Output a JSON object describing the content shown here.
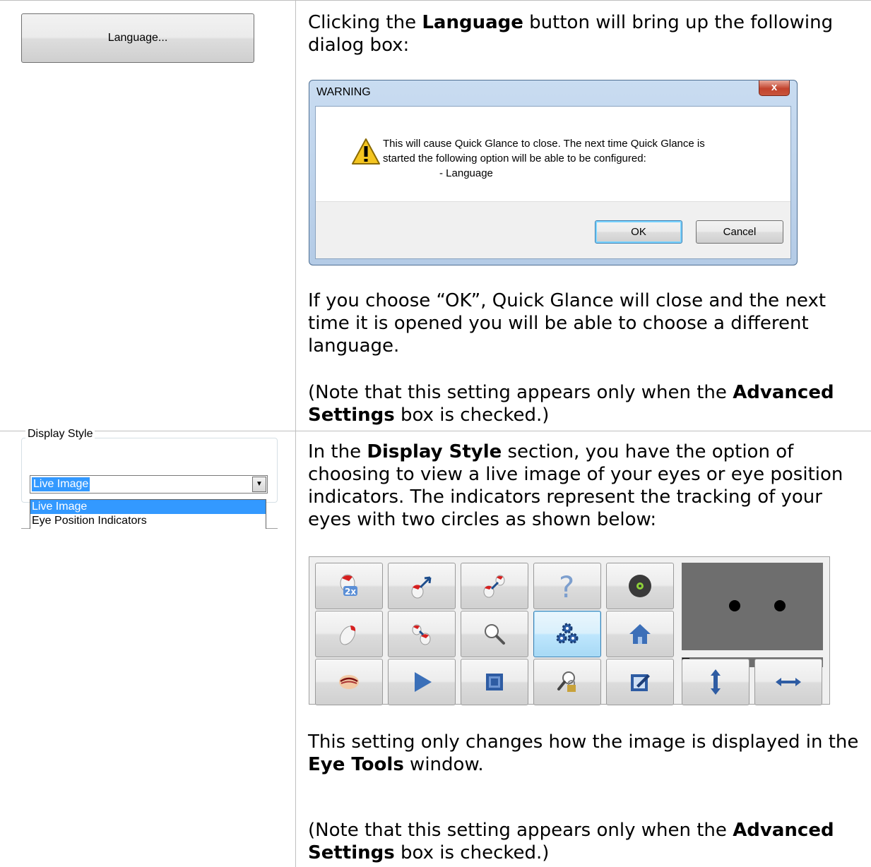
{
  "row1": {
    "language_button_label": "Language...",
    "intro": {
      "pre": "Clicking the ",
      "bold": "Language",
      "post": " button will bring up the following dialog box:"
    },
    "dialog": {
      "title": "WARNING",
      "close_label": "x",
      "message_line1": "This will cause Quick Glance to close. The next time Quick Glance is",
      "message_line2": "started the following option will be able to be configured:",
      "message_line3": "- Language",
      "ok_label": "OK",
      "cancel_label": "Cancel"
    },
    "para2": "If you choose “OK”, Quick Glance will close and the next time it is opened you will be able to choose a different language.",
    "note": {
      "pre": "(Note that this setting appears only when the ",
      "bold": "Advanced Settings",
      "post": " box is checked.)"
    }
  },
  "row2": {
    "group_label": "Display Style",
    "combo_value": "Live Image",
    "options": [
      "Live Image",
      "Eye Position Indicators"
    ],
    "para1": {
      "pre": "In the ",
      "bold": "Display Style",
      "post": " section, you have the option of choosing to view a live image of your eyes or eye position indicators. The indicators represent  the tracking of your eyes with two circles as shown below:"
    },
    "eye_tools": {
      "buttons": [
        {
          "icon": "zoom-2x-icon"
        },
        {
          "icon": "cursor-arrow-icon"
        },
        {
          "icon": "drag-icon"
        },
        {
          "icon": "help-question-icon"
        },
        {
          "icon": "target-disc-icon"
        },
        {
          "icon": "mouse-click-icon"
        },
        {
          "icon": "double-click-icon"
        },
        {
          "icon": "magnifier-icon"
        },
        {
          "icon": "settings-gears-icon"
        },
        {
          "icon": "home-icon"
        },
        {
          "icon": "eye-icon"
        },
        {
          "icon": "play-icon"
        },
        {
          "icon": "window-frame-icon"
        },
        {
          "icon": "lock-zoom-icon"
        },
        {
          "icon": "edit-icon"
        },
        {
          "icon": "vertical-scroll-icon"
        },
        {
          "icon": "horizontal-scroll-icon"
        }
      ],
      "progress_fraction": 0.05
    },
    "para2": {
      "pre": "This setting only changes how the image is displayed in the ",
      "bold": "Eye Tools",
      "post": " window."
    },
    "note": {
      "pre": "(Note that this setting appears only when the ",
      "bold": "Advanced Settings",
      "post": " box is checked.)"
    }
  }
}
